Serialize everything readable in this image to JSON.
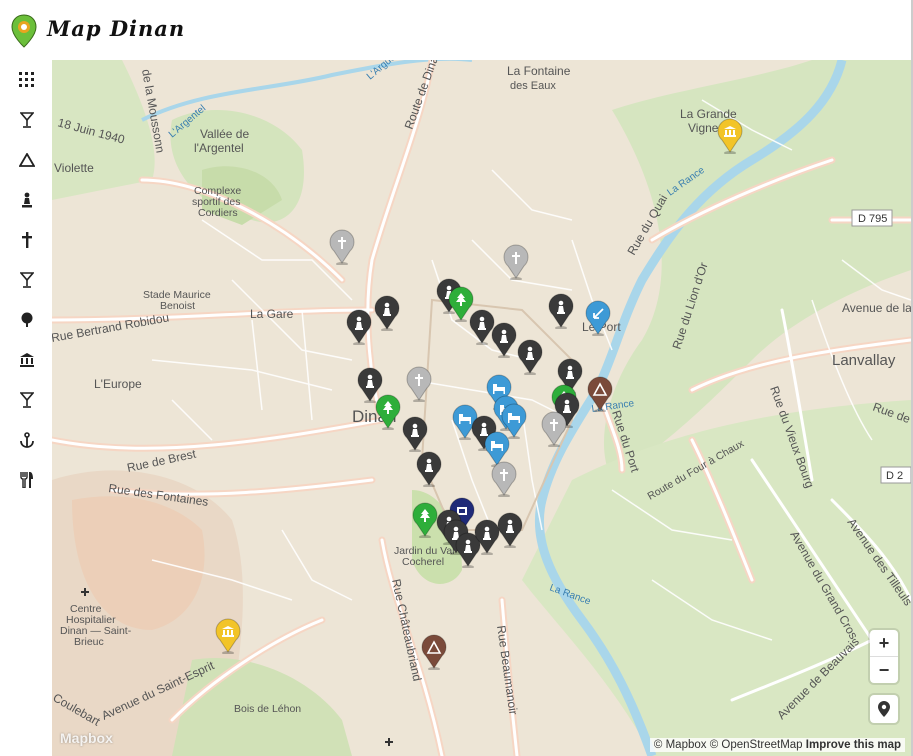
{
  "app": {
    "title": "Map Dinan"
  },
  "sidebar": {
    "items": [
      {
        "icon": "grid-icon"
      },
      {
        "icon": "cocktail-icon"
      },
      {
        "icon": "campsite-icon"
      },
      {
        "icon": "monument-icon"
      },
      {
        "icon": "church-cross-icon"
      },
      {
        "icon": "cocktail-icon"
      },
      {
        "icon": "tree-icon"
      },
      {
        "icon": "museum-icon"
      },
      {
        "icon": "cocktail-icon"
      },
      {
        "icon": "anchor-icon"
      },
      {
        "icon": "restaurant-icon"
      }
    ]
  },
  "map": {
    "labels": {
      "dinan": "Dinan",
      "lanvallay": "Lanvallay",
      "la_gare": "La Gare",
      "le_port": "Le Port",
      "leurope": "L'Europe",
      "la_fontaine_1": "La Fontaine",
      "la_fontaine_2": "des Eaux",
      "la_grande_1": "La Grande",
      "la_grande_2": "Vigne",
      "vallee_1": "Vallée de",
      "vallee_2": "l'Argentel",
      "complexe_1": "Complexe",
      "complexe_2": "sportif des",
      "complexe_3": "Cordiers",
      "stade_1": "Stade Maurice",
      "stade_2": "Benoist",
      "jardin_1": "Jardin du Val",
      "jardin_2": "Cocherel",
      "centre_1": "Centre",
      "centre_2": "Hospitalier",
      "centre_3": "Dinan — Saint-",
      "centre_4": "Brieuc",
      "bois": "Bois de Léhon",
      "rue_brest": "Rue de Brest",
      "rue_fontaines": "Rue des Fontaines",
      "rue_robidou": "Rue Bertrand Robidou",
      "rue_violette": "Violette",
      "rue_18juin": "18 Juin 1940",
      "route_dinard": "Route de Dinard",
      "rue_quai": "Rue du Quai",
      "rue_lion": "Rue du Lion d'Or",
      "rue_port": "Rue du Port",
      "rue_vieux_bourg": "Rue du Vieux Bourg",
      "rue_four": "Route du Four à Chaux",
      "av_grand_cros": "Avenue du Grand Cros",
      "av_tilleuls": "Avenue des Tilleuls",
      "av_beauvais": "Avenue de Beauvais",
      "av_saint_esprit": "Avenue du Saint-Esprit",
      "rue_chateaubriand": "Rue Châteaubriand",
      "rue_beaumanoir": "Rue Beaumanoir",
      "la_rance_1": "La Rance",
      "la_rance_2": "La Rance",
      "la_rance_3": "La Rance",
      "argentel": "L'Argentel",
      "argue": "L'Argue",
      "avenue_de_la": "Avenue de la",
      "rue_de": "Rue de",
      "coulebart": "Coulebart",
      "moussonnet": "de la Moussonn",
      "d795": "D 795",
      "d2": "D 2"
    }
  },
  "controls": {
    "zoom_in": "+",
    "zoom_out": "−"
  },
  "attribution": {
    "mapbox": "© Mapbox",
    "osm": "© OpenStreetMap",
    "improve": "Improve this map",
    "logo": "Mapbox"
  },
  "colors": {
    "marker_dark": "#3a3a3a",
    "marker_gray": "#b8b8b8",
    "marker_green": "#2eae3a",
    "marker_blue": "#3d9ad6",
    "marker_brown": "#7a4a3a",
    "marker_yellow": "#f2c428",
    "marker_navy": "#1f2a78",
    "river": "#a9d6ea",
    "road": "#ffffff"
  }
}
